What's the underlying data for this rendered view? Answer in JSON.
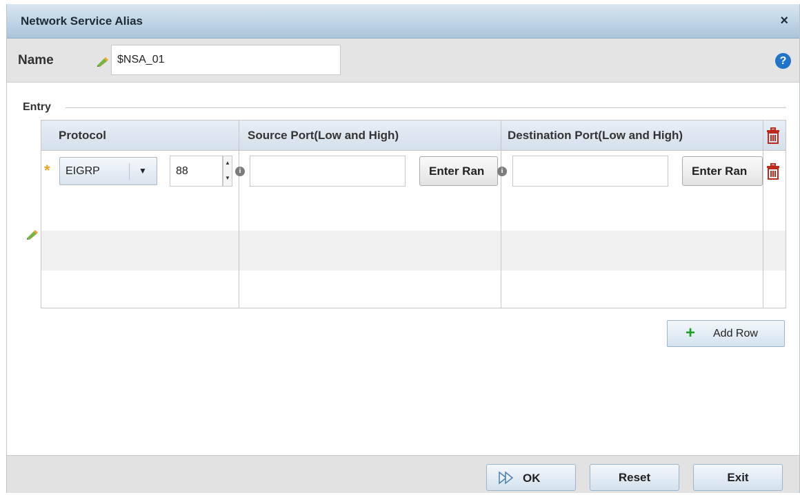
{
  "dialog": {
    "title": "Network Service Alias",
    "close_glyph": "×"
  },
  "name_bar": {
    "label": "Name",
    "value": "$NSA_01",
    "help_glyph": "?"
  },
  "entry": {
    "legend": "Entry",
    "columns": [
      "Protocol",
      "Source Port(Low and High)",
      "Destination Port(Low and High)"
    ],
    "rows": [
      {
        "protocol": "EIGRP",
        "protocol_number": "88",
        "source_port": "",
        "source_range_label": "Enter Ran",
        "destination_port": "",
        "destination_range_label": "Enter Ran"
      }
    ],
    "add_row_label": "Add Row"
  },
  "footer": {
    "ok_label": "OK",
    "reset_label": "Reset",
    "exit_label": "Exit"
  },
  "icons": {
    "required": "*",
    "info": "i",
    "select_arrow": "▼",
    "spin_up": "▲",
    "spin_down": "▼",
    "add": "+"
  },
  "colors": {
    "title_bar": "#aac5da",
    "help_icon": "#1f73c9",
    "trash_icon": "#c0281e",
    "add_icon": "#1f9e2a",
    "required_star": "#f0a020"
  }
}
